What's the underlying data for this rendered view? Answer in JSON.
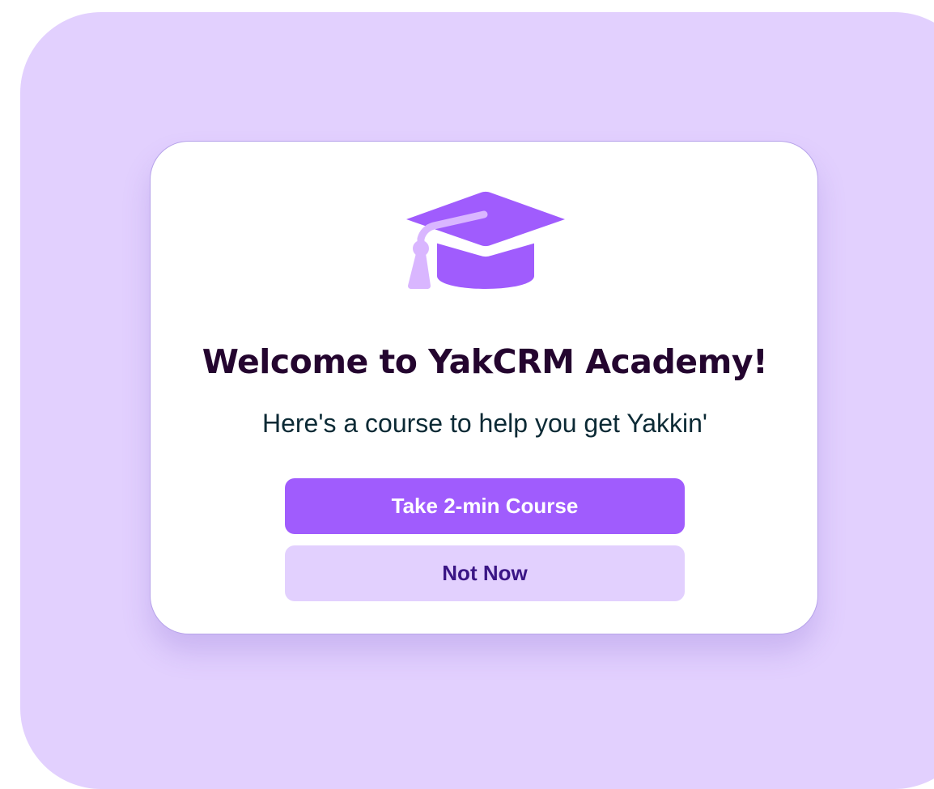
{
  "colors": {
    "background": "#e2d0fe",
    "accent": "#a05cfd",
    "tassel": "#d9b6ff",
    "title": "#24052f",
    "subtitle": "#0c2a35",
    "secondary_text": "#3a1585"
  },
  "modal": {
    "icon": "graduation-cap-icon",
    "title": "Welcome to YakCRM Academy!",
    "subtitle": "Here's a course to help you get Yakkin'",
    "primary_button": "Take 2-min Course",
    "secondary_button": "Not Now"
  }
}
